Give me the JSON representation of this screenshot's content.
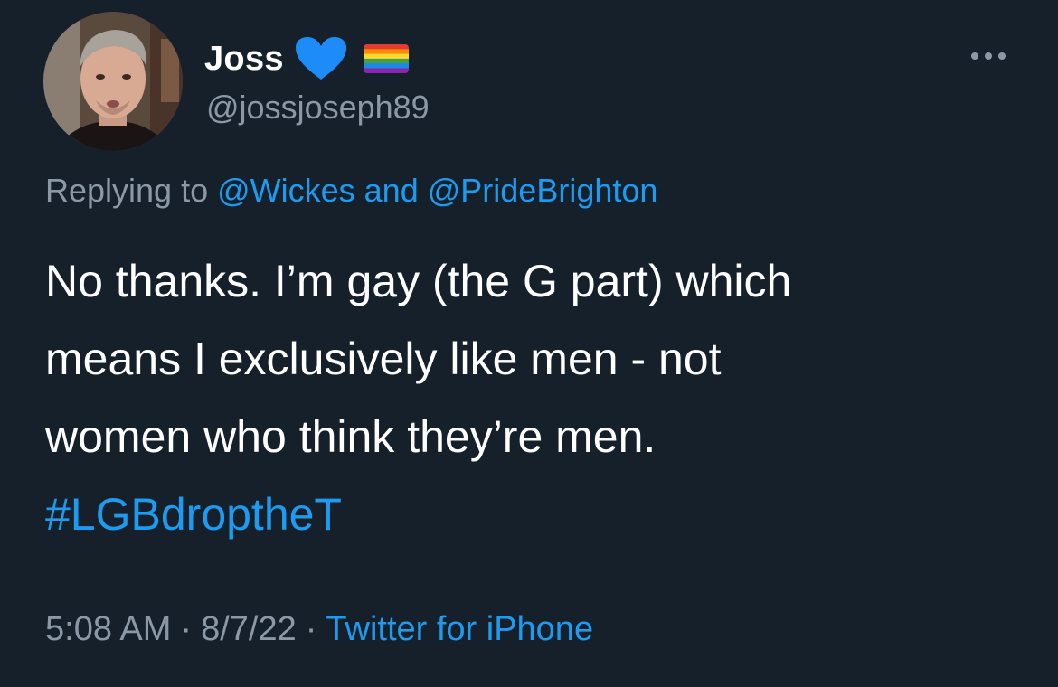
{
  "tweet": {
    "author": {
      "display_name": "Joss",
      "emoji_1": "blue-heart",
      "emoji_2": "rainbow-flag",
      "handle": "@jossjoseph89",
      "avatar_icon": "profile-photo"
    },
    "more_icon": "more-options-icon",
    "replying": {
      "prefix": "Replying to ",
      "user1": "@Wickes",
      "conjunction": " and ",
      "user2": "@PrideBrighton"
    },
    "body_lines": [
      "No thanks. I’m gay (the G part) which",
      "means I exclusively like men - not",
      "women who think they’re men."
    ],
    "hashtag": "#LGBdroptheT",
    "time": "5:08 AM",
    "date": "8/7/22",
    "separator": "·",
    "source": "Twitter for iPhone"
  },
  "colors": {
    "background": "#15202b",
    "text": "#ffffff",
    "secondary": "#8b98a5",
    "accent": "#1d9bf0",
    "heart": "#1d8cf8"
  }
}
